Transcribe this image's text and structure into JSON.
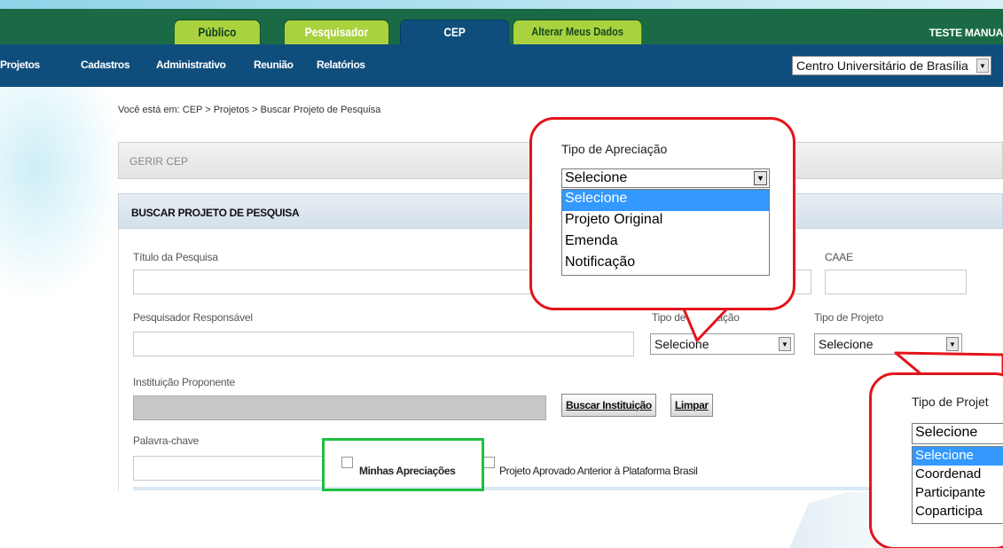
{
  "header": {
    "tabs": [
      "Público",
      "Pesquisador",
      "CEP",
      "Alterar Meus Dados"
    ],
    "active_tab": "CEP",
    "user_label": "TESTE MANUA"
  },
  "nav": {
    "items": [
      "Projetos",
      "Cadastros",
      "Administrativo",
      "Reunião",
      "Relatórios"
    ],
    "institution_select": "Centro Universitário de Brasília"
  },
  "breadcrumb": "Você está em: CEP > Projetos > Buscar Projeto de Pesquisa",
  "panels": {
    "gerir": "GERIR CEP",
    "buscar": "BUSCAR PROJETO DE PESQUISA"
  },
  "form": {
    "titulo_label": "Título da Pesquisa",
    "caae_label": "CAAE",
    "pesquisador_label": "Pesquisador Responsável",
    "tipo_apreciacao_label": "Tipo de Apreciação",
    "tipo_apreciacao_value": "Selecione",
    "tipo_projeto_label": "Tipo de Projeto",
    "tipo_projeto_value": "Selecione",
    "instituicao_label": "Instituição Proponente",
    "buscar_instituicao_button": "Buscar Instituição",
    "limpar_button": "Limpar",
    "palavra_chave_label": "Palavra-chave",
    "minhas_apreciacoes_label": "Minhas Apreciações",
    "projeto_aprovado_label": "Projeto Aprovado Anterior à Plataforma Brasil"
  },
  "callout_apreciacao": {
    "title": "Tipo de Apreciação",
    "selected": "Selecione",
    "options": [
      "Selecione",
      "Projeto Original",
      "Emenda",
      "Notificação"
    ]
  },
  "callout_projeto": {
    "title": "Tipo de Projet",
    "selected": "Selecione",
    "options": [
      "Selecione",
      "Coordenad",
      "Participante",
      "Coparticipa"
    ]
  },
  "colors": {
    "header_green": "#1a6b45",
    "nav_blue": "#0f4e7c",
    "tab_green": "#a9d23e",
    "callout_red": "#e4141b",
    "highlight_green": "#1fbf40",
    "option_highlight": "#3399ff"
  }
}
